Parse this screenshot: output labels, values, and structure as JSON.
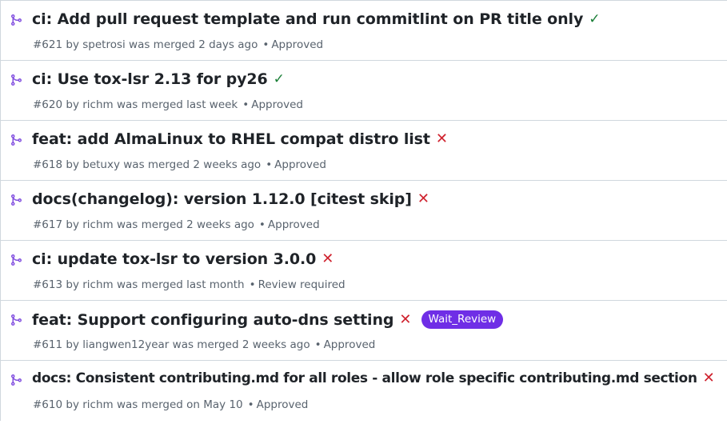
{
  "colors": {
    "merged_icon": "#8250df",
    "success": "#1a7f37",
    "failure": "#cf222e",
    "label_bg": "#6f2ee6",
    "meta_text": "#59636e"
  },
  "pull_requests": [
    {
      "title": "ci: Add pull request template and run commitlint on PR title only",
      "status_icon": "check-icon",
      "status_glyph": "✓",
      "number": "#621",
      "by": "by",
      "author": "spetrosi",
      "merged_text": "was merged",
      "time": "2 days ago",
      "separator": "•",
      "review": "Approved"
    },
    {
      "title": "ci: Use tox-lsr 2.13 for py26",
      "status_icon": "check-icon",
      "status_glyph": "✓",
      "number": "#620",
      "by": "by",
      "author": "richm",
      "merged_text": "was merged",
      "time": "last week",
      "separator": "•",
      "review": "Approved"
    },
    {
      "title": "feat: add AlmaLinux to RHEL compat distro list",
      "status_icon": "x-icon",
      "status_glyph": "✕",
      "number": "#618",
      "by": "by",
      "author": "betuxy",
      "merged_text": "was merged",
      "time": "2 weeks ago",
      "separator": "•",
      "review": "Approved"
    },
    {
      "title": "docs(changelog): version 1.12.0 [citest skip]",
      "status_icon": "x-icon",
      "status_glyph": "✕",
      "number": "#617",
      "by": "by",
      "author": "richm",
      "merged_text": "was merged",
      "time": "2 weeks ago",
      "separator": "•",
      "review": "Approved"
    },
    {
      "title": "ci: update tox-lsr to version 3.0.0",
      "status_icon": "x-icon",
      "status_glyph": "✕",
      "number": "#613",
      "by": "by",
      "author": "richm",
      "merged_text": "was merged",
      "time": "last month",
      "separator": "•",
      "review": "Review required"
    },
    {
      "title": "feat: Support configuring auto-dns setting",
      "status_icon": "x-icon",
      "status_glyph": "✕",
      "label": "Wait_Review",
      "number": "#611",
      "by": "by",
      "author": "liangwen12year",
      "merged_text": "was merged",
      "time": "2 weeks ago",
      "separator": "•",
      "review": "Approved"
    },
    {
      "title": "docs: Consistent contributing.md for all roles - allow role specific contributing.md section",
      "status_icon": "x-icon",
      "status_glyph": "✕",
      "number": "#610",
      "by": "by",
      "author": "richm",
      "merged_text": "was merged",
      "time": "on May 10",
      "separator": "•",
      "review": "Approved"
    }
  ]
}
